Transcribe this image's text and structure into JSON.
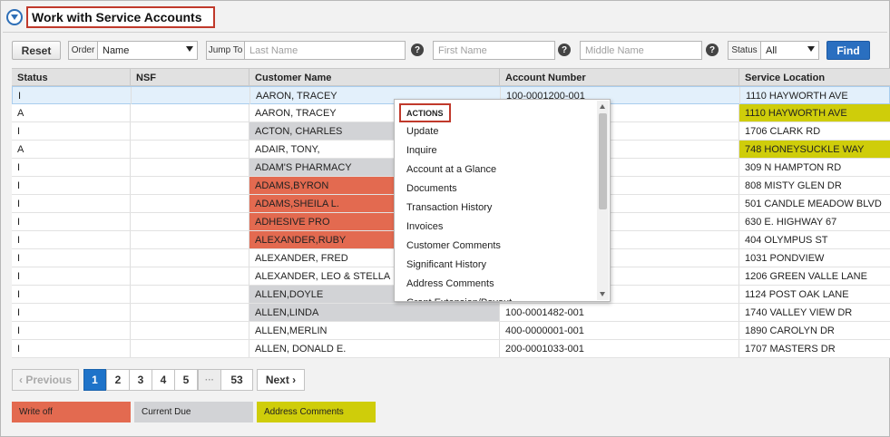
{
  "header": {
    "title": "Work with Service Accounts"
  },
  "filters": {
    "reset_label": "Reset",
    "order_label": "Order",
    "order_value": "Name",
    "jump_to_label": "Jump To",
    "last_name_placeholder": "Last Name",
    "first_name_placeholder": "First Name",
    "middle_name_placeholder": "Middle Name",
    "status_label": "Status",
    "status_value": "All",
    "find_label": "Find",
    "help_glyph": "?"
  },
  "table": {
    "columns": [
      "Status",
      "NSF",
      "Customer Name",
      "Account Number",
      "Service Location"
    ],
    "rows": [
      {
        "status": "I",
        "nsf": "",
        "name": "AARON, TRACEY",
        "account": "100-0001200-001",
        "location": "1110 HAYWORTH AVE"
      },
      {
        "status": "A",
        "nsf": "",
        "name": "AARON, TRACEY",
        "account": "",
        "location": "1110 HAYWORTH AVE"
      },
      {
        "status": "I",
        "nsf": "",
        "name": "ACTON, CHARLES",
        "account": "",
        "location": "1706 CLARK RD"
      },
      {
        "status": "A",
        "nsf": "",
        "name": "ADAIR, TONY,",
        "account": "",
        "location": "748 HONEYSUCKLE WAY"
      },
      {
        "status": "I",
        "nsf": "",
        "name": "ADAM'S PHARMACY",
        "account": "",
        "location": "309 N HAMPTON RD"
      },
      {
        "status": "I",
        "nsf": "",
        "name": "ADAMS,BYRON",
        "account": "",
        "location": "808 MISTY GLEN DR"
      },
      {
        "status": "I",
        "nsf": "",
        "name": "ADAMS,SHEILA L.",
        "account": "",
        "location": "501 CANDLE MEADOW BLVD"
      },
      {
        "status": "I",
        "nsf": "",
        "name": "ADHESIVE PRO",
        "account": "",
        "location": "630 E. HIGHWAY 67"
      },
      {
        "status": "I",
        "nsf": "",
        "name": "ALEXANDER,RUBY",
        "account": "",
        "location": "404 OLYMPUS ST"
      },
      {
        "status": "I",
        "nsf": "",
        "name": "ALEXANDER, FRED",
        "account": "",
        "location": "1031 PONDVIEW"
      },
      {
        "status": "I",
        "nsf": "",
        "name": "ALEXANDER, LEO & STELLA",
        "account": "",
        "location": "1206 GREEN VALLE LANE"
      },
      {
        "status": "I",
        "nsf": "",
        "name": "ALLEN,DOYLE",
        "account": "",
        "location": "1124 POST OAK LANE"
      },
      {
        "status": "I",
        "nsf": "",
        "name": "ALLEN,LINDA",
        "account": "100-0001482-001",
        "location": "1740 VALLEY VIEW DR"
      },
      {
        "status": "I",
        "nsf": "",
        "name": "ALLEN,MERLIN",
        "account": "400-0000001-001",
        "location": "1890 CAROLYN DR"
      },
      {
        "status": "I",
        "nsf": "",
        "name": "ALLEN, DONALD E.",
        "account": "200-0001033-001",
        "location": "1707 MASTERS DR"
      }
    ]
  },
  "context_menu": {
    "heading": "ACTIONS",
    "items": [
      "Update",
      "Inquire",
      "Account at a Glance",
      "Documents",
      "Transaction History",
      "Invoices",
      "Customer Comments",
      "Significant History",
      "Address Comments",
      "Grant Extension/Payout"
    ]
  },
  "pagination": {
    "previous_label": "‹ Previous",
    "next_label": "Next ›",
    "pages": [
      "1",
      "2",
      "3",
      "4",
      "5",
      "···",
      "53"
    ],
    "active_page": "1"
  },
  "legend": {
    "write_off": "Write off",
    "current_due": "Current Due",
    "address_comments": "Address Comments"
  },
  "colors": {
    "write_off": "#e36a50",
    "current_due": "#d2d3d6",
    "address_comments": "#cfcd0a",
    "accent": "#2a6fc0"
  }
}
